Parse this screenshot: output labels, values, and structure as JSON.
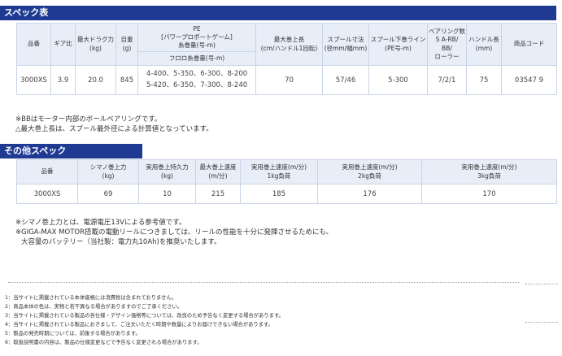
{
  "spec": {
    "title": "スペック表",
    "headers": {
      "model": "品番",
      "gear_ratio": "ギア比",
      "max_drag": "最大ドラグ力",
      "max_drag_unit": "(kg)",
      "weight": "自重",
      "weight_unit": "(g)",
      "pe_line1": "PE",
      "pe_line2": "[パワープロポートゲーム]",
      "pe_line3": "糸巻量(号-m)",
      "fluoro": "フロロ糸巻量(号-m)",
      "max_retrieve": "最大巻上長",
      "max_retrieve_unit": "(cm/ハンドル1回転)",
      "spool_size": "スプール寸法",
      "spool_size_unit": "(径mm/幅mm)",
      "under_line": "スプール下巻ライン",
      "under_line_unit": "(PE号-m)",
      "bearing1": "ベアリング数",
      "bearing2": "S A-RB/",
      "bearing3": "BB/",
      "bearing4": "ローラー",
      "handle": "ハンドル長",
      "handle_unit": "(mm)",
      "code": "商品コード"
    },
    "row": {
      "model": "3000XS",
      "gear_ratio": "3.9",
      "max_drag": "20.0",
      "weight": "845",
      "pe": "4-400、5-350、6-300、8-200",
      "fluoro": "5-420、6-350、7-300、8-240",
      "max_retrieve": "70",
      "spool_size": "57/46",
      "under_line": "5-300",
      "bearing": "7/2/1",
      "handle": "75",
      "code": "03547 9"
    },
    "notes": [
      "※BBはモーター内部のボールベアリングです。",
      "△最大巻上長は、スプール最外径による計算値となっています。"
    ]
  },
  "other": {
    "title": "その他スペック",
    "headers": {
      "model": "品番",
      "winding_power": "シマノ巻上力",
      "winding_power_unit": "(kg)",
      "practical_power": "実用巻上持久力",
      "practical_power_unit": "(kg)",
      "max_speed": "最大巻上速度",
      "max_speed_unit": "(m/分)",
      "speed_1kg": "実用巻上速度(m/分)",
      "speed_1kg_load": "1kg負荷",
      "speed_2kg": "実用巻上速度(m/分)",
      "speed_2kg_load": "2kg負荷",
      "speed_3kg": "実用巻上速度(m/分)",
      "speed_3kg_load": "3kg負荷"
    },
    "row": {
      "model": "3000XS",
      "winding_power": "69",
      "practical_power": "10",
      "max_speed": "215",
      "speed_1kg": "185",
      "speed_2kg": "176",
      "speed_3kg": "170"
    },
    "notes": [
      "※シマノ巻上力とは、電源電圧13Vによる参考値です。",
      "※GIGA-MAX MOTOR搭載の電動リールにつきましては、リールの性能を十分に発揮させるためにも、",
      "大容量のバッテリー（当社製：電力丸10Ah)を推奨いたします。"
    ]
  },
  "footnotes": [
    "1：当サイトに掲載されている本体価格には消費税は含まれておりません。",
    "2：商品本体の色は、実物と若干異なる場合がありますのでご了承ください。",
    "3：当サイトに掲載されている製品の各仕様・デザイン価格等については、改良のため予告なく変更する場合があります。",
    "4：当サイトに掲載されている製品におきまして、ご注文いただく時期や数量によりお届けできない場合があります。",
    "5：製品の発売時期については、前後する場合があります。",
    "6：取扱説明書の内容は、製品の仕様変更などで予告なく変更される場合があります。"
  ]
}
